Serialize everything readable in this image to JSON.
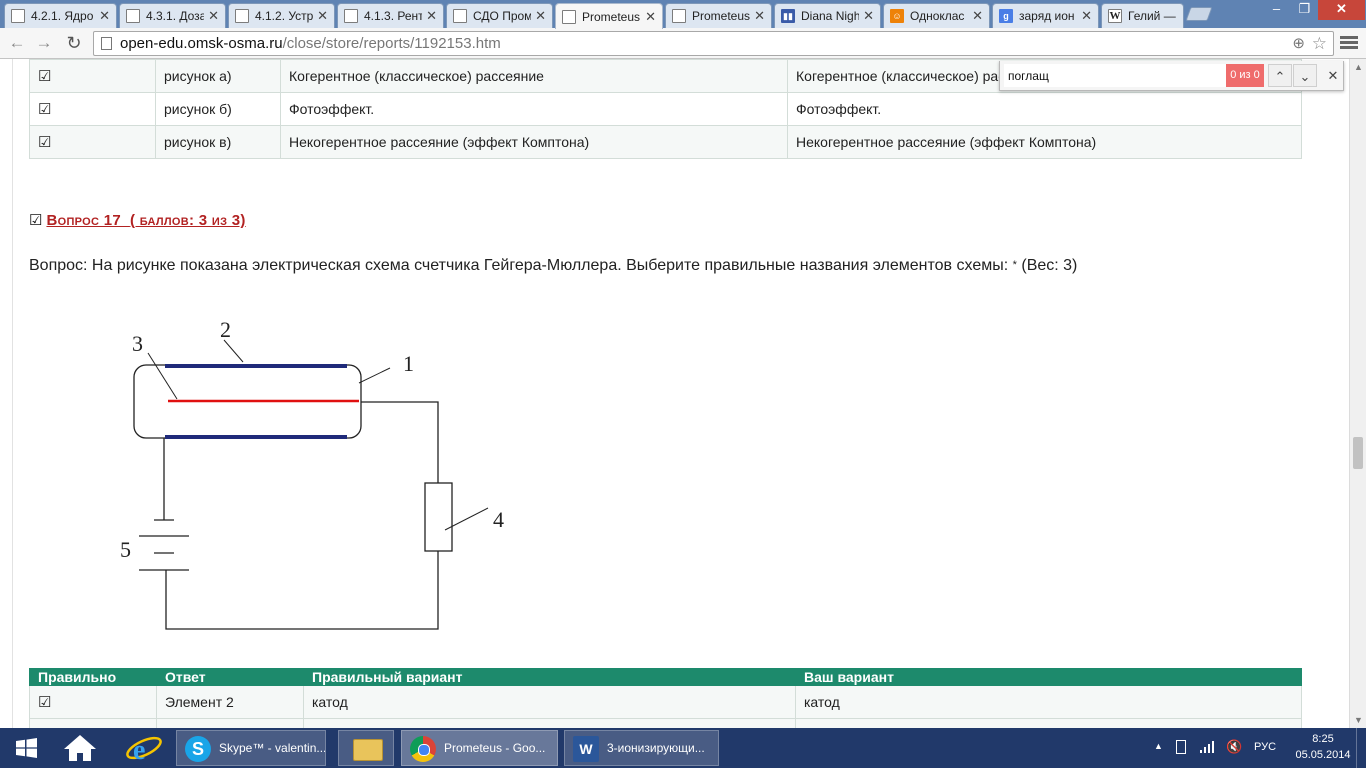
{
  "browser": {
    "tabs": [
      {
        "title": "4.2.1. Ядро",
        "icon": "page-icon",
        "active": false
      },
      {
        "title": "4.3.1. Доза",
        "icon": "page-icon",
        "active": false
      },
      {
        "title": "4.1.2. Устр",
        "icon": "page-icon",
        "active": false
      },
      {
        "title": "4.1.3. Рент",
        "icon": "page-icon",
        "active": false
      },
      {
        "title": "СДО Пром",
        "icon": "page-icon",
        "active": false
      },
      {
        "title": "Prometeus",
        "icon": "page-icon",
        "active": true
      },
      {
        "title": "Prometeus",
        "icon": "page-icon",
        "active": false
      },
      {
        "title": "Diana Nigh",
        "icon": "blog-icon",
        "active": false
      },
      {
        "title": "Одноклас",
        "icon": "ok-icon",
        "active": false
      },
      {
        "title": "заряд ион",
        "icon": "google-icon",
        "active": false
      },
      {
        "title": "Гелий — В",
        "icon": "wikipedia-icon",
        "active": false
      }
    ],
    "tab_close": "✕",
    "win_min": "–",
    "win_max": "❐",
    "win_close": "✕",
    "nav": {
      "back": "←",
      "forward": "→",
      "reload": "↻"
    },
    "url_host": "open-edu.omsk-osma.ru",
    "url_path": "/close/store/reports/1192153.htm",
    "zoom_icon": "⊕",
    "star_icon": "☆"
  },
  "find": {
    "value": "поглащ",
    "count": "0 из 0",
    "prev": "⌃",
    "next": "⌄",
    "close": "✕"
  },
  "prev_table": {
    "rows": [
      {
        "check": "☑",
        "answer": "рисунок а)",
        "correct": "Когерентное (классическое) рассеяние",
        "yours": "Когерентное (классическое) рассеяние"
      },
      {
        "check": "☑",
        "answer": "рисунок б)",
        "correct": "Фотоэффект.",
        "yours": "Фотоэффект."
      },
      {
        "check": "☑",
        "answer": "рисунок в)",
        "correct": "Некогерентное рассеяние (эффект Комптона)",
        "yours": "Некогерентное рассеяние (эффект Комптона)"
      }
    ]
  },
  "question": {
    "checkbox": "☑",
    "title": "Вопрос 17",
    "score": "( баллов: 3 из 3)",
    "text": "Вопрос: На рисунке показана электрическая схема счетчика Гейгера-Мюллера. Выберите правильные названия элементов схемы:",
    "required_mark": "*",
    "weight": "(Вес: 3)"
  },
  "figure": {
    "labels": [
      "1",
      "2",
      "3",
      "4",
      "5"
    ],
    "colors": {
      "plates": "#1f2a7a",
      "anode": "#e01010",
      "wire": "#222222"
    }
  },
  "answers": {
    "headers": [
      "Правильно",
      "Ответ",
      "Правильный вариант",
      "Ваш вариант"
    ],
    "rows": [
      {
        "check": "☑",
        "answer": "Элемент 2",
        "correct": "катод",
        "yours": "катод"
      }
    ],
    "header_color": "#1d8a6c"
  },
  "taskbar": {
    "skype": "Skype™ - valentin...",
    "chrome": "Prometeus - Goo...",
    "word": "3-ионизирующи...",
    "lang": "РУС",
    "time": "8:25",
    "date": "05.05.2014"
  }
}
